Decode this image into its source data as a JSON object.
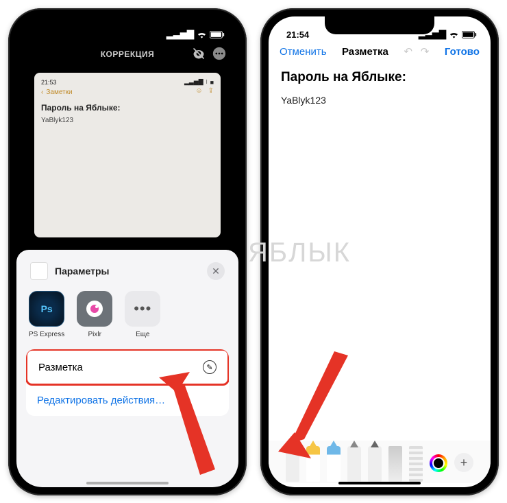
{
  "left": {
    "status": {
      "time": "",
      "signal": "▂▃▅▇",
      "wifi": "⧙",
      "battery": "■"
    },
    "topbar": {
      "title": "КОРРЕКЦИЯ"
    },
    "preview": {
      "time": "21:53",
      "notes_back": "Заметки",
      "heading": "Пароль на Яблыке:",
      "text": "YaBlyk123"
    },
    "sheet": {
      "options_label": "Параметры",
      "apps": {
        "ps": "PS Express",
        "pixlr": "Pixlr",
        "more": "Еще"
      },
      "markup_label": "Разметка",
      "edit_actions_label": "Редактировать действия…"
    }
  },
  "right": {
    "status": {
      "time": "21:54"
    },
    "header": {
      "cancel": "Отменить",
      "title": "Разметка",
      "done": "Готово"
    },
    "body": {
      "heading": "Пароль на Яблыке:",
      "text": "YaBlyk123"
    }
  },
  "watermark": "ЯБЛЫК"
}
